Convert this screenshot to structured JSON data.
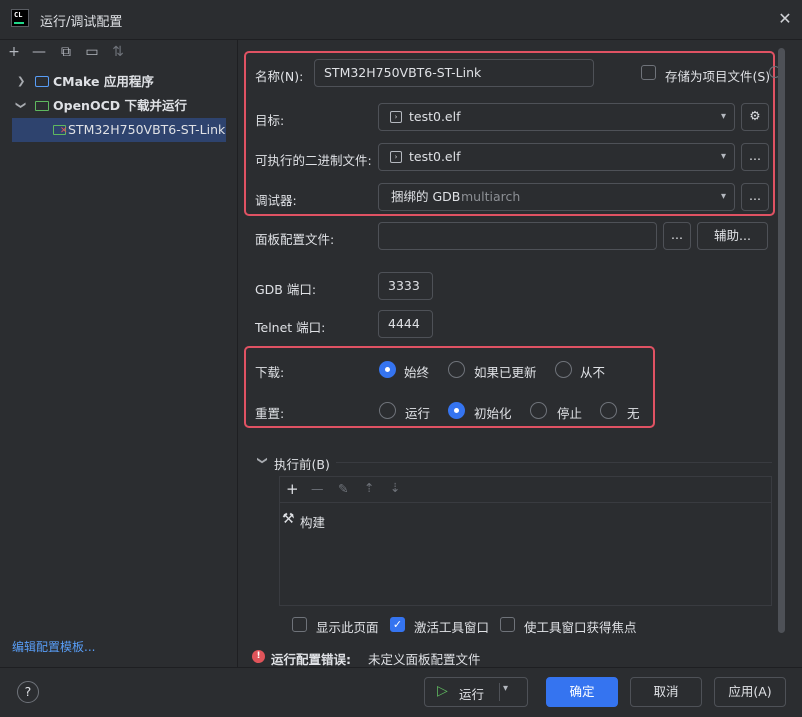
{
  "window": {
    "logo_text": "CL",
    "title": "运行/调试配置",
    "close_glyph": "✕"
  },
  "sidebar": {
    "toolbar": [
      {
        "name": "add-icon",
        "glyph": "+"
      },
      {
        "name": "remove-icon",
        "glyph": "—"
      },
      {
        "name": "copy-icon",
        "glyph": "⧉"
      },
      {
        "name": "new-folder-icon",
        "glyph": "▭"
      },
      {
        "name": "sort-icon",
        "glyph": "⇅"
      }
    ],
    "tree": [
      {
        "label": "CMake 应用程序",
        "expanded": false
      },
      {
        "label": "OpenOCD 下载并运行",
        "expanded": true
      },
      {
        "label": "STM32H750VBT6-ST-Link",
        "selected": true
      }
    ],
    "edit_templates_link": "编辑配置模板..."
  },
  "form": {
    "name_label": "名称(N):",
    "name_value": "STM32H750VBT6-ST-Link",
    "store_as_project_label": "存储为项目文件(S)",
    "target_label": "目标:",
    "target_value": "test0.elf",
    "executable_label": "可执行的二进制文件:",
    "executable_value": "test0.elf",
    "debugger_label": "调试器:",
    "debugger_value": "捆绑的 GDB",
    "debugger_hint": "multiarch",
    "board_config_label": "面板配置文件:",
    "board_config_value": "",
    "browse_glyph": "...",
    "assist_label": "辅助...",
    "gdb_port_label": "GDB 端口:",
    "gdb_port_value": "3333",
    "telnet_port_label": "Telnet 端口:",
    "telnet_port_value": "4444",
    "download_label": "下载:",
    "download_options": [
      {
        "label": "始终",
        "checked": true
      },
      {
        "label": "如果已更新",
        "checked": false
      },
      {
        "label": "从不",
        "checked": false
      }
    ],
    "reset_label": "重置:",
    "reset_options": [
      {
        "label": "运行",
        "checked": false
      },
      {
        "label": "初始化",
        "checked": true
      },
      {
        "label": "停止",
        "checked": false
      },
      {
        "label": "无",
        "checked": false
      }
    ],
    "before_launch_label": "执行前(B)",
    "before_launch_task": "构建",
    "show_page_label": "显示此页面",
    "activate_tool_window_label": "激活工具窗口",
    "focus_tool_window_label": "使工具窗口获得焦点",
    "error_prefix": "运行配置错误:",
    "error_message": "未定义面板配置文件"
  },
  "footer": {
    "help_glyph": "?",
    "run_label": "运行",
    "ok_label": "确定",
    "cancel_label": "取消",
    "apply_label": "应用(A)"
  },
  "colors": {
    "accent": "#3574f0",
    "highlight": "#e05263",
    "error": "#e0545a",
    "background": "#2b2d30"
  }
}
